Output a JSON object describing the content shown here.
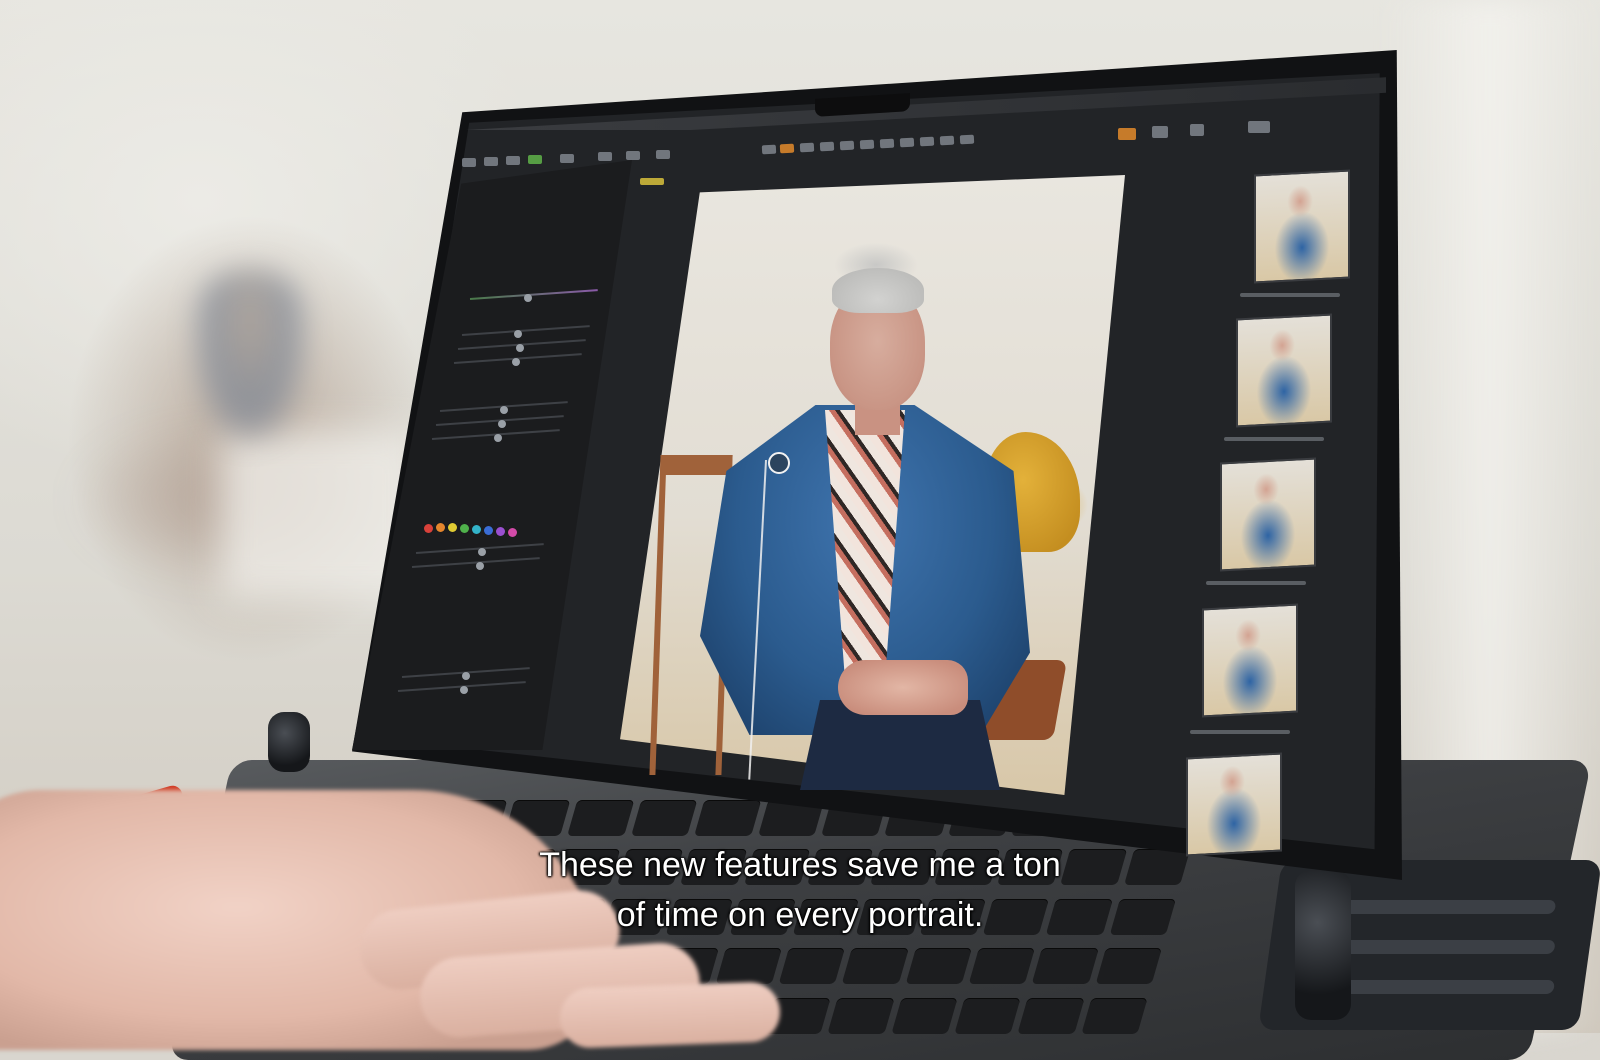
{
  "subtitle": {
    "line1": "These new features save me a ton",
    "line2": "of time on every portrait."
  }
}
